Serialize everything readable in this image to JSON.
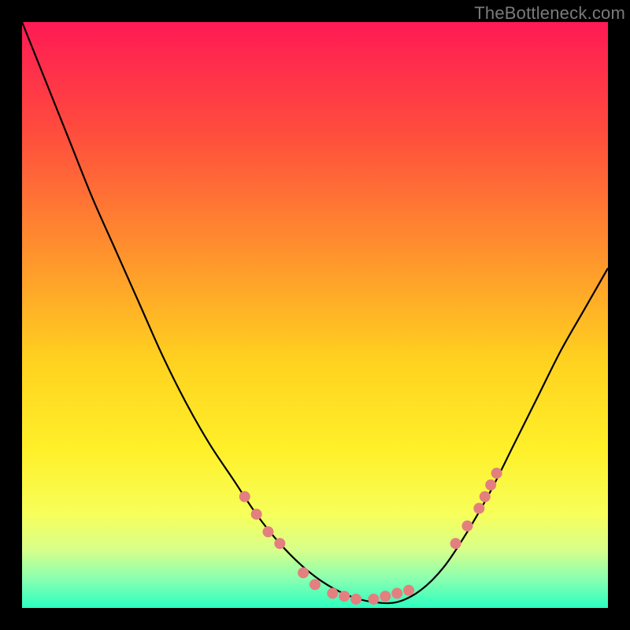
{
  "watermark": "TheBottleneck.com",
  "chart_data": {
    "type": "line",
    "title": "",
    "xlabel": "",
    "ylabel": "",
    "xlim": [
      0,
      100
    ],
    "ylim": [
      0,
      100
    ],
    "grid": false,
    "legend": false,
    "background_gradient_stops": [
      {
        "offset": 0.0,
        "color": "#ff1a55"
      },
      {
        "offset": 0.18,
        "color": "#ff4a3e"
      },
      {
        "offset": 0.38,
        "color": "#ff8d2e"
      },
      {
        "offset": 0.58,
        "color": "#ffd21f"
      },
      {
        "offset": 0.73,
        "color": "#fff029"
      },
      {
        "offset": 0.84,
        "color": "#f7ff5a"
      },
      {
        "offset": 0.9,
        "color": "#d8ff8a"
      },
      {
        "offset": 0.95,
        "color": "#8affb0"
      },
      {
        "offset": 1.0,
        "color": "#2bffc0"
      }
    ],
    "series": [
      {
        "name": "bottleneck-curve",
        "color": "#000000",
        "x": [
          0,
          4,
          8,
          12,
          16,
          20,
          24,
          28,
          32,
          36,
          40,
          44,
          48,
          52,
          56,
          60,
          64,
          68,
          72,
          76,
          80,
          84,
          88,
          92,
          96,
          100
        ],
        "y": [
          100,
          90,
          80,
          70,
          61,
          52,
          43,
          35,
          28,
          22,
          16,
          11,
          7,
          4,
          2,
          1,
          1,
          3,
          7,
          13,
          20,
          28,
          36,
          44,
          51,
          58
        ]
      }
    ],
    "markers": {
      "name": "highlight-dots",
      "color": "#e37f7f",
      "radius": 7,
      "points": [
        {
          "x": 38,
          "y": 19
        },
        {
          "x": 40,
          "y": 16
        },
        {
          "x": 42,
          "y": 13
        },
        {
          "x": 44,
          "y": 11
        },
        {
          "x": 48,
          "y": 6
        },
        {
          "x": 50,
          "y": 4
        },
        {
          "x": 53,
          "y": 2.5
        },
        {
          "x": 55,
          "y": 2
        },
        {
          "x": 57,
          "y": 1.5
        },
        {
          "x": 60,
          "y": 1.5
        },
        {
          "x": 62,
          "y": 2
        },
        {
          "x": 64,
          "y": 2.5
        },
        {
          "x": 66,
          "y": 3
        },
        {
          "x": 74,
          "y": 11
        },
        {
          "x": 76,
          "y": 14
        },
        {
          "x": 78,
          "y": 17
        },
        {
          "x": 79,
          "y": 19
        },
        {
          "x": 80,
          "y": 21
        },
        {
          "x": 81,
          "y": 23
        }
      ]
    }
  }
}
